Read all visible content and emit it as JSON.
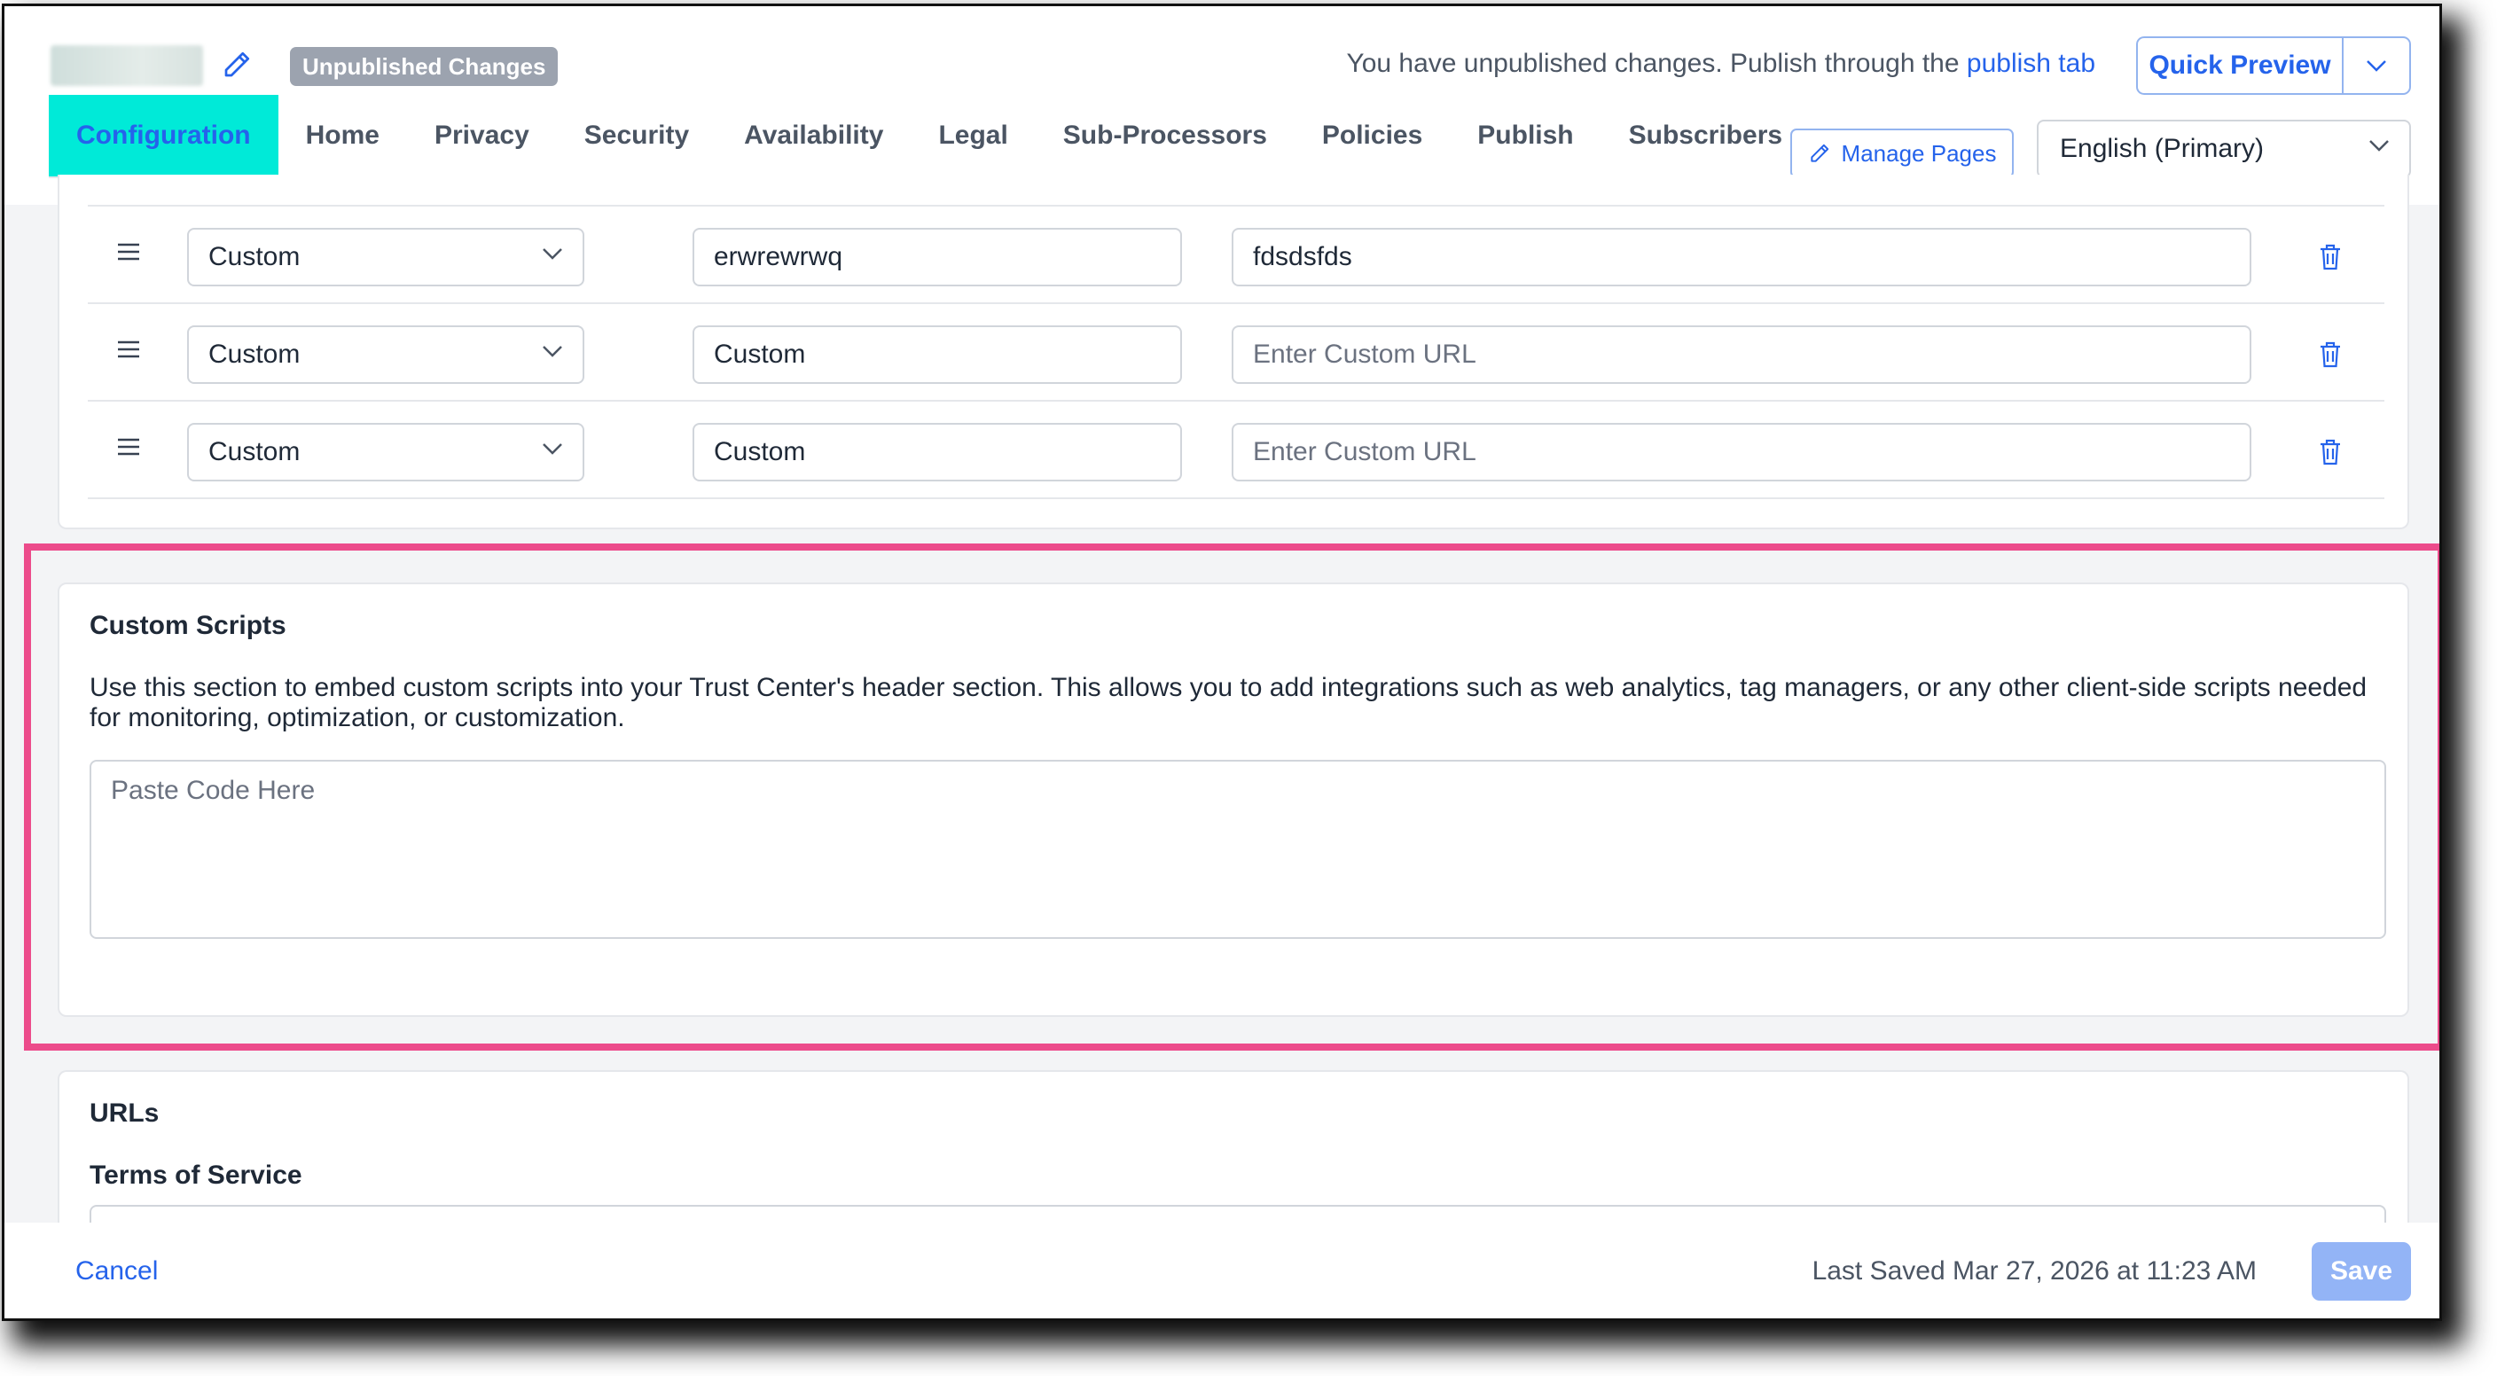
{
  "header": {
    "badge": "Unpublished Changes",
    "notice_text": "You have unpublished changes. Publish through the",
    "notice_link": "publish tab",
    "quick_preview": "Quick Preview"
  },
  "tabs": [
    {
      "label": "Configuration",
      "active": true
    },
    {
      "label": "Home"
    },
    {
      "label": "Privacy"
    },
    {
      "label": "Security"
    },
    {
      "label": "Availability"
    },
    {
      "label": "Legal"
    },
    {
      "label": "Sub-Processors"
    },
    {
      "label": "Policies"
    },
    {
      "label": "Publish"
    },
    {
      "label": "Subscribers"
    }
  ],
  "manage_pages": "Manage Pages",
  "language": "English (Primary)",
  "link_rows": [
    {
      "type": "Custom",
      "label": "erwrewrwq",
      "url": "fdsdsfds",
      "url_placeholder": "Enter Custom URL"
    },
    {
      "type": "Custom",
      "label": "Custom",
      "url": "",
      "url_placeholder": "Enter Custom URL"
    },
    {
      "type": "Custom",
      "label": "Custom",
      "url": "",
      "url_placeholder": "Enter Custom URL"
    }
  ],
  "custom_scripts": {
    "title": "Custom Scripts",
    "description": "Use this section to embed custom scripts into your Trust Center's header section. This allows you to add integrations such as web analytics, tag managers, or any other client-side scripts needed for monitoring, optimization, or customization.",
    "placeholder": "Paste Code Here"
  },
  "urls": {
    "title": "URLs",
    "terms_label": "Terms of Service"
  },
  "footer": {
    "cancel": "Cancel",
    "last_saved": "Last Saved Mar 27, 2026 at 11:23 AM",
    "save": "Save"
  },
  "colors": {
    "accent": "#2563eb",
    "active_tab_bg": "#00ead8",
    "highlight": "#ec4b8b",
    "badge_bg": "#9ca3af"
  }
}
